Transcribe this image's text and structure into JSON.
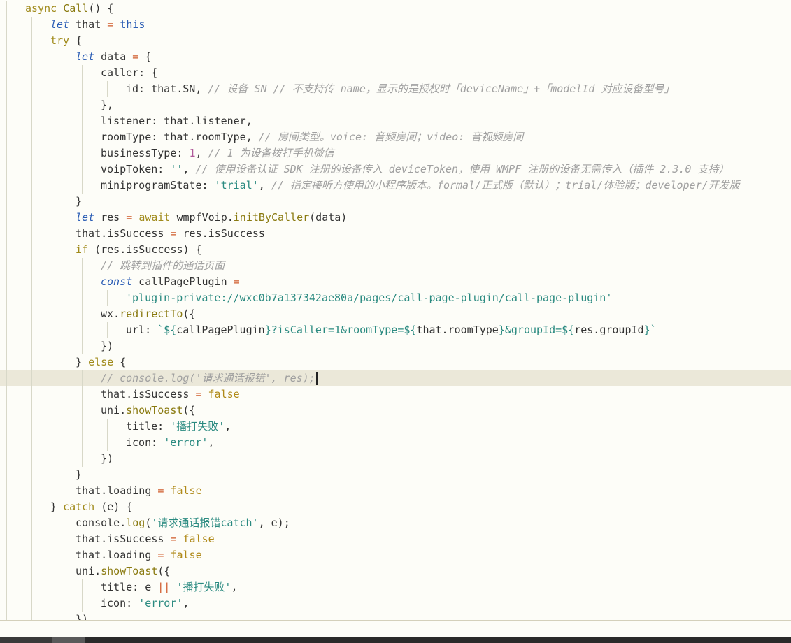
{
  "editor": {
    "colors": {
      "background": "#fdfdf8",
      "current_line": "#ebe8d9",
      "default": "#333333",
      "keyword": "#a08a1a",
      "decl": "#2b5db5",
      "function": "#8a7a10",
      "operator": "#d05a2a",
      "string": "#2a8a80",
      "comment": "#a0a0a0",
      "number": "#b05a9a",
      "boolean": "#b08a1a",
      "template": "#2a8a80"
    },
    "current_line_index": 23,
    "lines": [
      {
        "indent": 1,
        "tokens": [
          {
            "t": "async ",
            "c": "keyword"
          },
          {
            "t": "Call",
            "c": "function"
          },
          {
            "t": "() {",
            "c": "default"
          }
        ]
      },
      {
        "indent": 2,
        "tokens": [
          {
            "t": "let",
            "c": "decl",
            "i": true
          },
          {
            "t": " that ",
            "c": "default"
          },
          {
            "t": "=",
            "c": "operator"
          },
          {
            "t": " ",
            "c": "default"
          },
          {
            "t": "this",
            "c": "decl"
          }
        ]
      },
      {
        "indent": 2,
        "tokens": [
          {
            "t": "try",
            "c": "keyword"
          },
          {
            "t": " {",
            "c": "default"
          }
        ]
      },
      {
        "indent": 3,
        "tokens": [
          {
            "t": "let",
            "c": "decl",
            "i": true
          },
          {
            "t": " data ",
            "c": "default"
          },
          {
            "t": "=",
            "c": "operator"
          },
          {
            "t": " {",
            "c": "default"
          }
        ]
      },
      {
        "indent": 4,
        "tokens": [
          {
            "t": "caller: {",
            "c": "default"
          }
        ]
      },
      {
        "indent": 5,
        "tokens": [
          {
            "t": "id: that.SN, ",
            "c": "default"
          },
          {
            "t": "// 设备 SN // 不支持传 name，显示的是授权时「deviceName」+「modelId 对应设备型号」",
            "c": "comment",
            "i": true
          }
        ]
      },
      {
        "indent": 4,
        "tokens": [
          {
            "t": "},",
            "c": "default"
          }
        ]
      },
      {
        "indent": 4,
        "tokens": [
          {
            "t": "listener: that.listener,",
            "c": "default"
          }
        ]
      },
      {
        "indent": 4,
        "tokens": [
          {
            "t": "roomType: that.roomType, ",
            "c": "default"
          },
          {
            "t": "// 房间类型。voice: 音频房间；video: 音视频房间",
            "c": "comment",
            "i": true
          }
        ]
      },
      {
        "indent": 4,
        "tokens": [
          {
            "t": "businessType: ",
            "c": "default"
          },
          {
            "t": "1",
            "c": "number"
          },
          {
            "t": ", ",
            "c": "default"
          },
          {
            "t": "// 1 为设备拨打手机微信",
            "c": "comment",
            "i": true
          }
        ]
      },
      {
        "indent": 4,
        "tokens": [
          {
            "t": "voipToken: ",
            "c": "default"
          },
          {
            "t": "''",
            "c": "string"
          },
          {
            "t": ", ",
            "c": "default"
          },
          {
            "t": "// 使用设备认证 SDK 注册的设备传入 deviceToken，使用 WMPF 注册的设备无需传入（插件 2.3.0 支持）",
            "c": "comment",
            "i": true
          }
        ]
      },
      {
        "indent": 4,
        "tokens": [
          {
            "t": "miniprogramState: ",
            "c": "default"
          },
          {
            "t": "'trial'",
            "c": "string"
          },
          {
            "t": ", ",
            "c": "default"
          },
          {
            "t": "// 指定接听方使用的小程序版本。formal/正式版（默认）；trial/体验版；developer/开发版",
            "c": "comment",
            "i": true
          }
        ]
      },
      {
        "indent": 3,
        "tokens": [
          {
            "t": "}",
            "c": "default"
          }
        ]
      },
      {
        "indent": 3,
        "tokens": [
          {
            "t": "let",
            "c": "decl",
            "i": true
          },
          {
            "t": " res ",
            "c": "default"
          },
          {
            "t": "=",
            "c": "operator"
          },
          {
            "t": " ",
            "c": "default"
          },
          {
            "t": "await",
            "c": "keyword"
          },
          {
            "t": " wmpfVoip.",
            "c": "default"
          },
          {
            "t": "initByCaller",
            "c": "function"
          },
          {
            "t": "(data)",
            "c": "default"
          }
        ]
      },
      {
        "indent": 3,
        "tokens": [
          {
            "t": "that.isSuccess ",
            "c": "default"
          },
          {
            "t": "=",
            "c": "operator"
          },
          {
            "t": " res.isSuccess",
            "c": "default"
          }
        ]
      },
      {
        "indent": 3,
        "tokens": [
          {
            "t": "if",
            "c": "keyword"
          },
          {
            "t": " (res.isSuccess) {",
            "c": "default"
          }
        ]
      },
      {
        "indent": 4,
        "tokens": [
          {
            "t": "// 跳转到插件的通话页面",
            "c": "comment",
            "i": true
          }
        ]
      },
      {
        "indent": 4,
        "tokens": [
          {
            "t": "const",
            "c": "decl",
            "i": true
          },
          {
            "t": " callPagePlugin ",
            "c": "default"
          },
          {
            "t": "=",
            "c": "operator"
          }
        ]
      },
      {
        "indent": 5,
        "tokens": [
          {
            "t": "'plugin-private://wxc0b7a137342ae80a/pages/call-page-plugin/call-page-plugin'",
            "c": "string"
          }
        ]
      },
      {
        "indent": 4,
        "tokens": [
          {
            "t": "wx.",
            "c": "default"
          },
          {
            "t": "redirectTo",
            "c": "function"
          },
          {
            "t": "({",
            "c": "default"
          }
        ]
      },
      {
        "indent": 5,
        "tokens": [
          {
            "t": "url: ",
            "c": "default"
          },
          {
            "t": "`${",
            "c": "template"
          },
          {
            "t": "callPagePlugin",
            "c": "default"
          },
          {
            "t": "}?isCaller=1&roomType=${",
            "c": "template"
          },
          {
            "t": "that.roomType",
            "c": "default"
          },
          {
            "t": "}&groupId=${",
            "c": "template"
          },
          {
            "t": "res.groupId",
            "c": "default"
          },
          {
            "t": "}`",
            "c": "template"
          }
        ]
      },
      {
        "indent": 4,
        "tokens": [
          {
            "t": "})",
            "c": "default"
          }
        ]
      },
      {
        "indent": 3,
        "tokens": [
          {
            "t": "} ",
            "c": "default"
          },
          {
            "t": "else",
            "c": "keyword"
          },
          {
            "t": " {",
            "c": "default"
          }
        ]
      },
      {
        "indent": 4,
        "tokens": [
          {
            "t": "// console.log('请求通话报错', res);",
            "c": "comment",
            "i": true
          }
        ],
        "cursor": true
      },
      {
        "indent": 4,
        "tokens": [
          {
            "t": "that.isSuccess ",
            "c": "default"
          },
          {
            "t": "=",
            "c": "operator"
          },
          {
            "t": " ",
            "c": "default"
          },
          {
            "t": "false",
            "c": "boolean"
          }
        ]
      },
      {
        "indent": 4,
        "tokens": [
          {
            "t": "uni.",
            "c": "default"
          },
          {
            "t": "showToast",
            "c": "function"
          },
          {
            "t": "({",
            "c": "default"
          }
        ]
      },
      {
        "indent": 5,
        "tokens": [
          {
            "t": "title: ",
            "c": "default"
          },
          {
            "t": "'播打失败'",
            "c": "string"
          },
          {
            "t": ",",
            "c": "default"
          }
        ]
      },
      {
        "indent": 5,
        "tokens": [
          {
            "t": "icon: ",
            "c": "default"
          },
          {
            "t": "'error'",
            "c": "string"
          },
          {
            "t": ",",
            "c": "default"
          }
        ]
      },
      {
        "indent": 4,
        "tokens": [
          {
            "t": "})",
            "c": "default"
          }
        ]
      },
      {
        "indent": 3,
        "tokens": [
          {
            "t": "}",
            "c": "default"
          }
        ]
      },
      {
        "indent": 3,
        "tokens": [
          {
            "t": "that.loading ",
            "c": "default"
          },
          {
            "t": "=",
            "c": "operator"
          },
          {
            "t": " ",
            "c": "default"
          },
          {
            "t": "false",
            "c": "boolean"
          }
        ]
      },
      {
        "indent": 2,
        "tokens": [
          {
            "t": "} ",
            "c": "default"
          },
          {
            "t": "catch",
            "c": "keyword"
          },
          {
            "t": " (e) {",
            "c": "default"
          }
        ]
      },
      {
        "indent": 3,
        "tokens": [
          {
            "t": "console.",
            "c": "default"
          },
          {
            "t": "log",
            "c": "function"
          },
          {
            "t": "(",
            "c": "default"
          },
          {
            "t": "'请求通话报错catch'",
            "c": "string"
          },
          {
            "t": ", e);",
            "c": "default"
          }
        ]
      },
      {
        "indent": 3,
        "tokens": [
          {
            "t": "that.isSuccess ",
            "c": "default"
          },
          {
            "t": "=",
            "c": "operator"
          },
          {
            "t": " ",
            "c": "default"
          },
          {
            "t": "false",
            "c": "boolean"
          }
        ]
      },
      {
        "indent": 3,
        "tokens": [
          {
            "t": "that.loading ",
            "c": "default"
          },
          {
            "t": "=",
            "c": "operator"
          },
          {
            "t": " ",
            "c": "default"
          },
          {
            "t": "false",
            "c": "boolean"
          }
        ]
      },
      {
        "indent": 3,
        "tokens": [
          {
            "t": "uni.",
            "c": "default"
          },
          {
            "t": "showToast",
            "c": "function"
          },
          {
            "t": "({",
            "c": "default"
          }
        ]
      },
      {
        "indent": 4,
        "tokens": [
          {
            "t": "title: e ",
            "c": "default"
          },
          {
            "t": "||",
            "c": "operator"
          },
          {
            "t": " ",
            "c": "default"
          },
          {
            "t": "'播打失败'",
            "c": "string"
          },
          {
            "t": ",",
            "c": "default"
          }
        ]
      },
      {
        "indent": 4,
        "tokens": [
          {
            "t": "icon: ",
            "c": "default"
          },
          {
            "t": "'error'",
            "c": "string"
          },
          {
            "t": ",",
            "c": "default"
          }
        ]
      },
      {
        "indent": 3,
        "tokens": [
          {
            "t": "})",
            "c": "default"
          }
        ]
      }
    ]
  }
}
